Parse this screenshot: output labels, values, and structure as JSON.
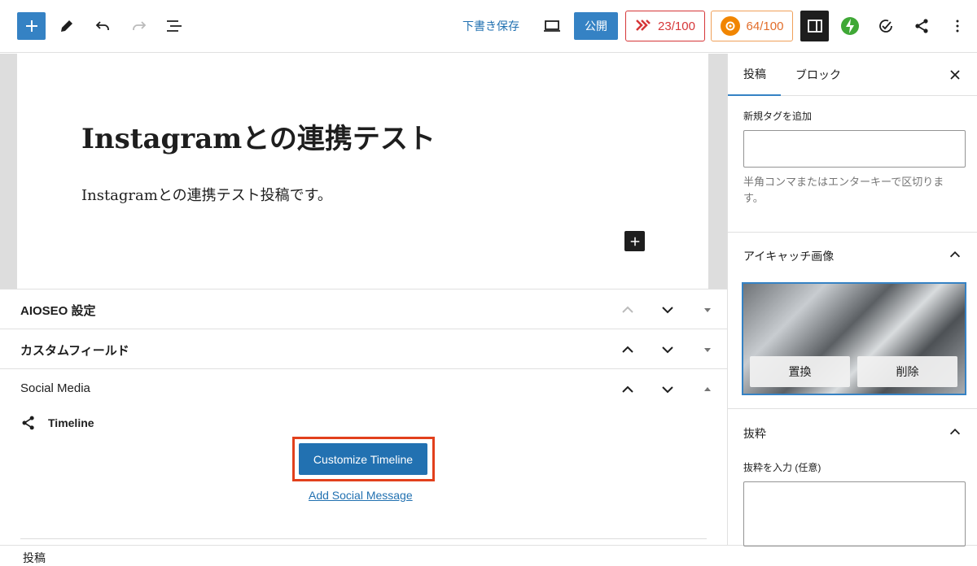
{
  "toolbar": {
    "draft_label": "下書き保存",
    "publish_label": "公開",
    "score1": "23/100",
    "score2": "64/100"
  },
  "post": {
    "title": "Instagramとの連携テスト",
    "paragraph": "Instagramとの連携テスト投稿です。"
  },
  "metaboxes": {
    "aioseo": "AIOSEO 設定",
    "custom_fields": "カスタムフィールド",
    "social_media": "Social Media"
  },
  "social": {
    "timeline_label": "Timeline",
    "customize_label": "Customize Timeline",
    "add_message_label": "Add Social Message"
  },
  "statusbar": {
    "breadcrumb": "投稿"
  },
  "sidebar": {
    "tab_post": "投稿",
    "tab_block": "ブロック",
    "tag_label": "新規タグを追加",
    "tag_help": "半角コンマまたはエンターキーで区切ります。",
    "featured_title": "アイキャッチ画像",
    "replace_label": "置換",
    "remove_label": "削除",
    "excerpt_title": "抜粋",
    "excerpt_label": "抜粋を入力 (任意)"
  },
  "colors": {
    "accent": "#3582c4",
    "link": "#2271b1",
    "highlight": "#e2401c"
  }
}
